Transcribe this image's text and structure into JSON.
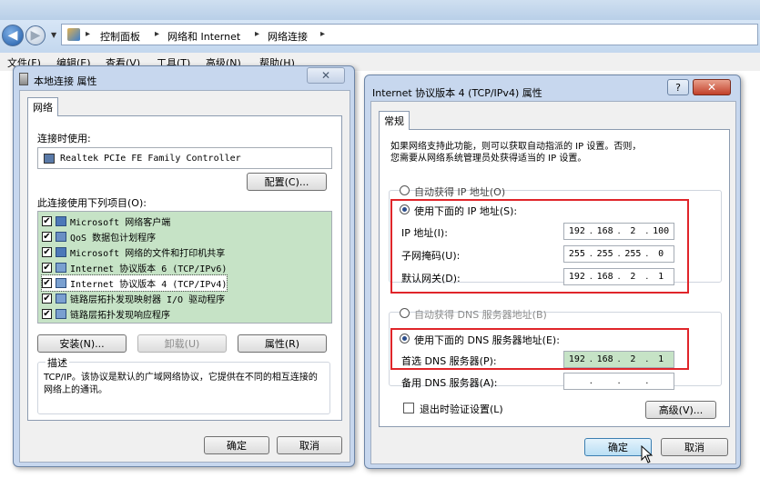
{
  "explorer": {
    "breadcrumbs": [
      "控制面板",
      "网络和 Internet",
      "网络连接"
    ],
    "menu": [
      "文件(F)",
      "编辑(E)",
      "查看(V)",
      "工具(T)",
      "高级(N)",
      "帮助(H)"
    ]
  },
  "local_conn": {
    "title": "本地连接 属性",
    "tab": "网络",
    "connect_using_label": "连接时使用:",
    "adapter": "Realtek PCIe FE Family Controller",
    "configure_button": "配置(C)...",
    "items_label": "此连接使用下列项目(O):",
    "items": [
      {
        "label": "Microsoft 网络客户端",
        "checked": true,
        "icon": "network-client-icon"
      },
      {
        "label": "QoS 数据包计划程序",
        "checked": true,
        "icon": "qos-scheduler-icon"
      },
      {
        "label": "Microsoft 网络的文件和打印机共享",
        "checked": true,
        "icon": "file-printer-sharing-icon"
      },
      {
        "label": "Internet 协议版本 6 (TCP/IPv6)",
        "checked": true,
        "icon": "protocol-icon"
      },
      {
        "label": "Internet 协议版本 4 (TCP/IPv4)",
        "checked": true,
        "icon": "protocol-icon"
      },
      {
        "label": "链路层拓扑发现映射器 I/O 驱动程序",
        "checked": true,
        "icon": "protocol-icon"
      },
      {
        "label": "链路层拓扑发现响应程序",
        "checked": true,
        "icon": "protocol-icon"
      }
    ],
    "install_button": "安装(N)...",
    "uninstall_button": "卸载(U)",
    "properties_button": "属性(R)",
    "description_title": "描述",
    "description_text": "TCP/IP。该协议是默认的广域网络协议，它提供在不同的相互连接的网络上的通讯。",
    "ok_button": "确定",
    "cancel_button": "取消"
  },
  "ipv4": {
    "title": "Internet 协议版本 4 (TCP/IPv4) 属性",
    "help_glyph": "?",
    "tab": "常规",
    "intro_line1": "如果网络支持此功能，则可以获取自动指派的 IP 设置。否则，",
    "intro_line2": "您需要从网络系统管理员处获得适当的 IP 设置。",
    "auto_ip_label": "自动获得 IP 地址(O)",
    "manual_ip_label": "使用下面的 IP 地址(S):",
    "ip_address_label": "IP 地址(I):",
    "ip_address": [
      "192",
      "168",
      "2",
      "100"
    ],
    "subnet_label": "子网掩码(U):",
    "subnet": [
      "255",
      "255",
      "255",
      "0"
    ],
    "gateway_label": "默认网关(D):",
    "gateway": [
      "192",
      "168",
      "2",
      "1"
    ],
    "auto_dns_label": "自动获得 DNS 服务器地址(B)",
    "manual_dns_label": "使用下面的 DNS 服务器地址(E):",
    "preferred_dns_label": "首选 DNS 服务器(P):",
    "preferred_dns": [
      "192",
      "168",
      "2",
      "1"
    ],
    "alternate_dns_label": "备用 DNS 服务器(A):",
    "alternate_dns": [
      "",
      "",
      "",
      ""
    ],
    "validate_label": "退出时验证设置(L)",
    "advanced_button": "高级(V)...",
    "ok_button": "确定",
    "cancel_button": "取消"
  },
  "colors": {
    "highlight_red": "#e0252a",
    "list_bg": "#c6e3c6",
    "dialog_frame": "#c7d7ee"
  }
}
